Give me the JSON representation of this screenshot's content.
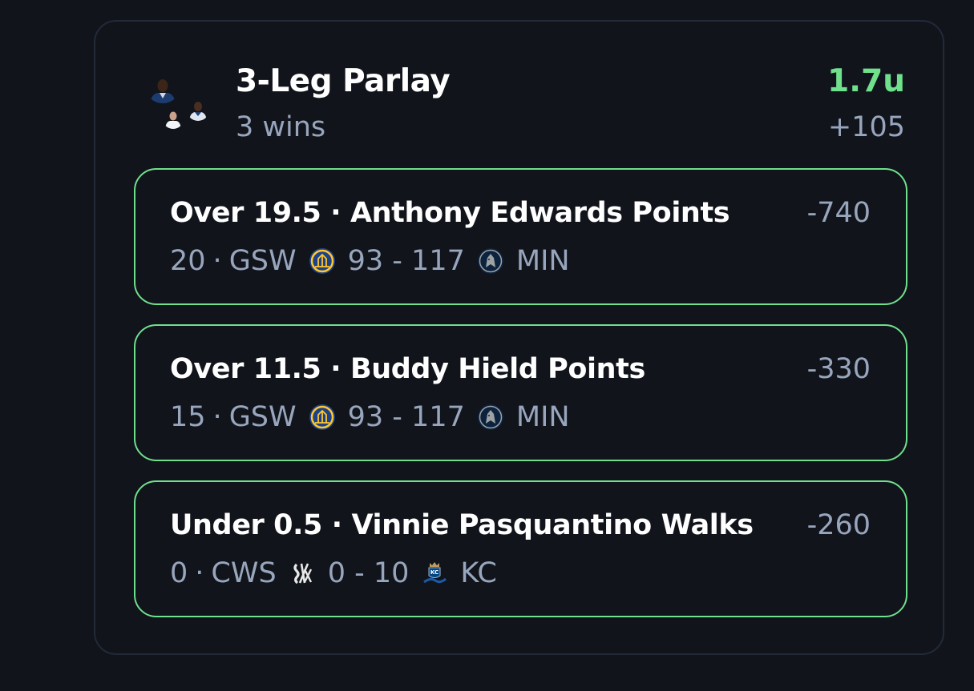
{
  "parlay": {
    "title": "3-Leg Parlay",
    "subtitle": "3 wins",
    "units": "1.7u",
    "odds": "+105"
  },
  "colors": {
    "background": "#11141b",
    "card_border": "#222a38",
    "win_green": "#6fe08c",
    "muted_text": "#98a6bd",
    "primary_text": "#ffffff"
  },
  "legs": [
    {
      "title": "Over 19.5 · Anthony Edwards Points",
      "odds": "-740",
      "result": "20",
      "dot": "·",
      "away_team": "GSW",
      "away_logo": "warriors-logo-icon",
      "score": "93 - 117",
      "home_team": "MIN",
      "home_logo": "timberwolves-logo-icon"
    },
    {
      "title": "Over 11.5 · Buddy Hield Points",
      "odds": "-330",
      "result": "15",
      "dot": "·",
      "away_team": "GSW",
      "away_logo": "warriors-logo-icon",
      "score": "93 - 117",
      "home_team": "MIN",
      "home_logo": "timberwolves-logo-icon"
    },
    {
      "title": "Under 0.5 · Vinnie Pasquantino Walks",
      "odds": "-260",
      "result": "0",
      "dot": "·",
      "away_team": "CWS",
      "away_logo": "white-sox-logo-icon",
      "score": "0 - 10",
      "home_team": "KC",
      "home_logo": "royals-logo-icon"
    }
  ]
}
